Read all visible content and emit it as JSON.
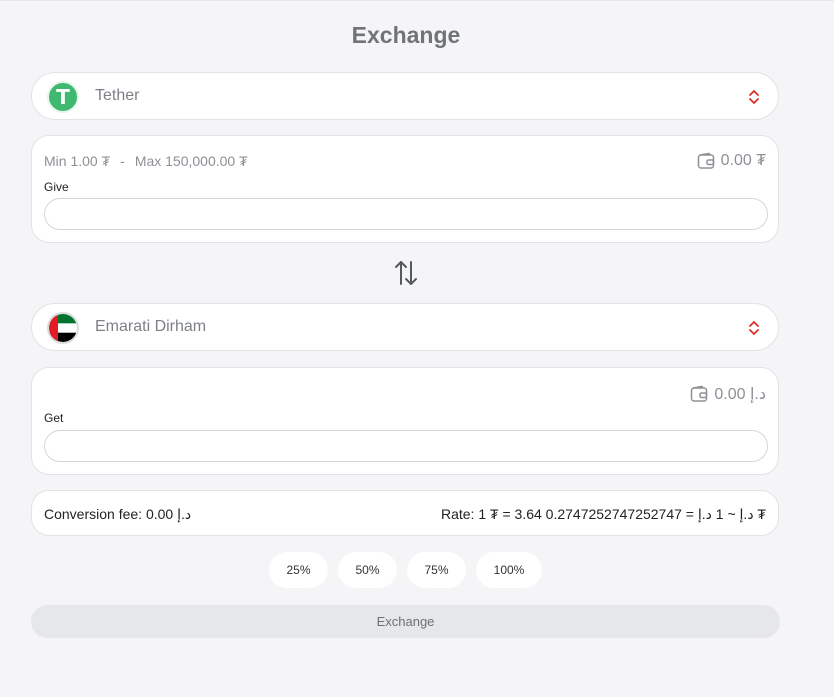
{
  "header": {
    "title": "Exchange"
  },
  "give": {
    "currency": "Tether",
    "coin_glyph": "T",
    "min_label": "Min 1.00 ₮",
    "separator": "-",
    "max_label": "Max 150,000.00 ₮",
    "balance": "0.00 ₮",
    "field_label": "Give",
    "input_value": "",
    "input_placeholder": ""
  },
  "get": {
    "currency": "Emarati Dirham",
    "balance": "0.00 د.إ",
    "field_label": "Get",
    "input_value": "",
    "input_placeholder": ""
  },
  "summary": {
    "fee": "Conversion fee: 0.00 د.إ",
    "rate": "Rate: 1 ₮ = 3.64 د.إ ~ 1 د.إ = 0.2747252747252747 ₮"
  },
  "percent_buttons": [
    "25%",
    "50%",
    "75%",
    "100%"
  ],
  "actions": {
    "exchange_label": "Exchange"
  },
  "icons": {
    "selector_chevron": "chevron-up-down-icon",
    "swap": "swap-arrows-icon",
    "wallet": "wallet-icon"
  },
  "colors": {
    "tether_green": "#3fb96f",
    "chevron_red": "#e0302e",
    "button_disabled_bg": "#e6e7e9"
  }
}
